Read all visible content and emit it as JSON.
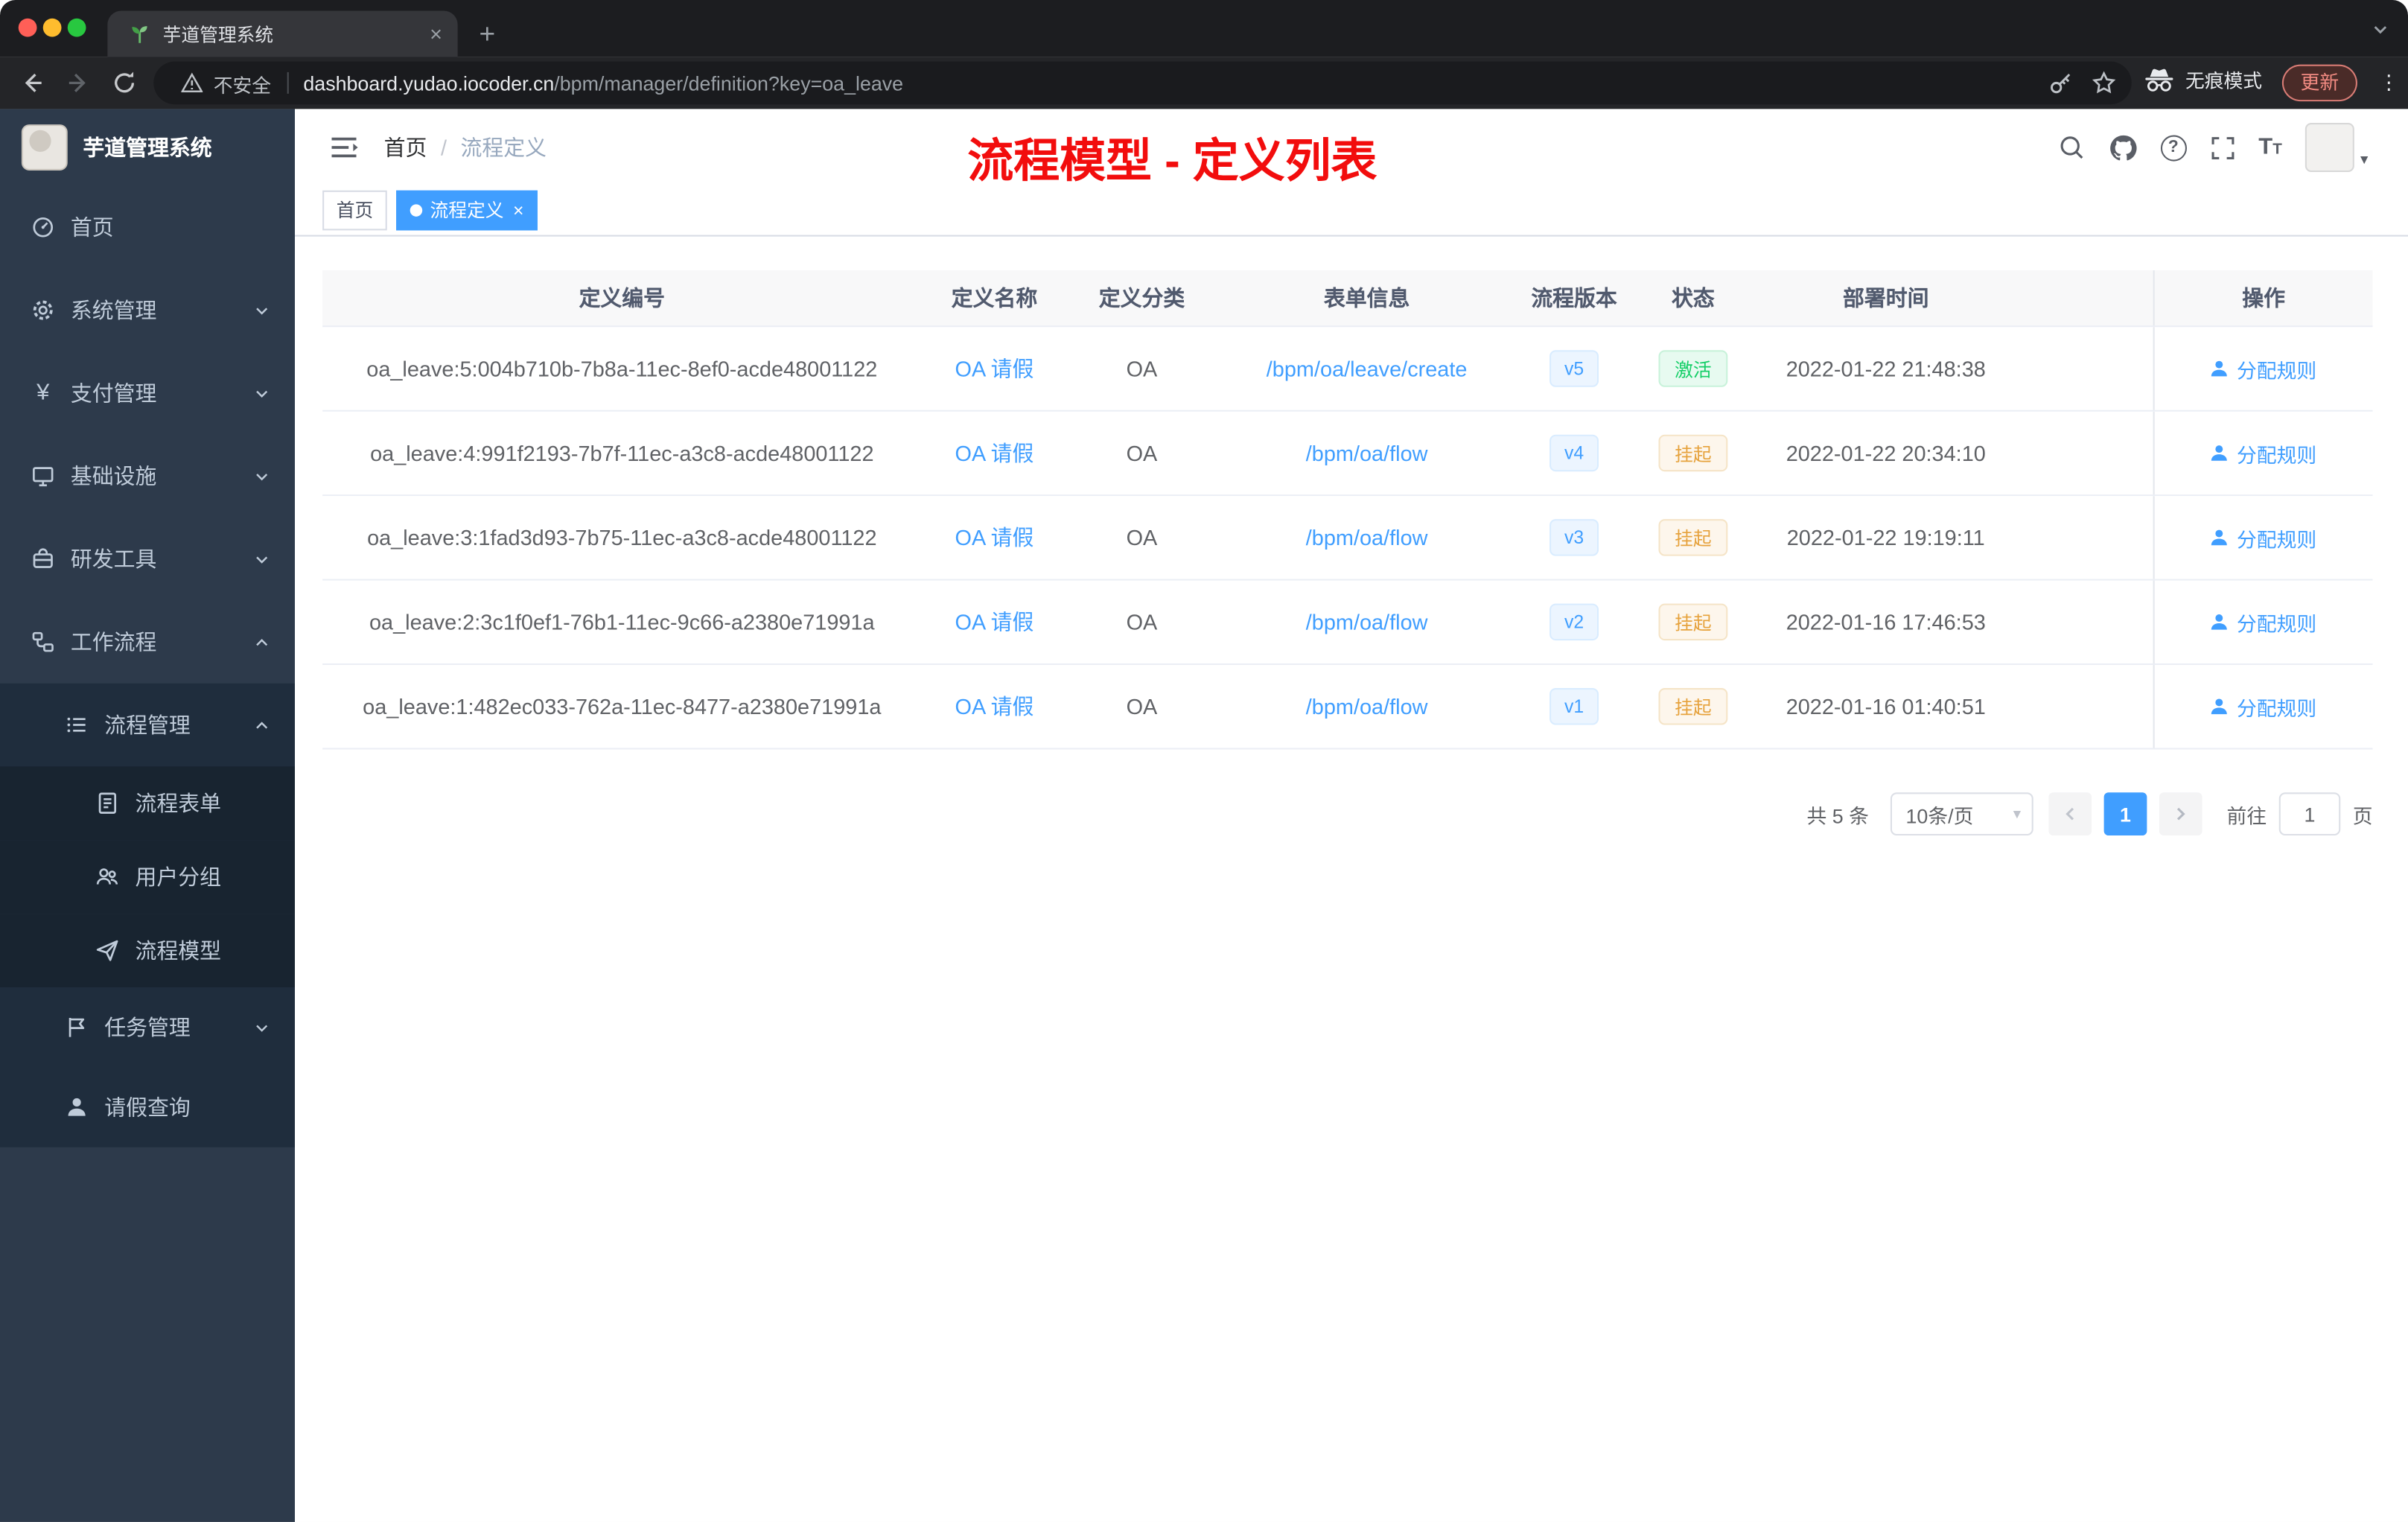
{
  "browser": {
    "tab_title": "芋道管理系统",
    "security_label": "不安全",
    "url_domain": "dashboard.yudao.iocoder.cn",
    "url_path": "/bpm/manager/definition?key=oa_leave",
    "incognito_label": "无痕模式",
    "update_label": "更新"
  },
  "sidebar": {
    "app_title": "芋道管理系统",
    "items": [
      {
        "label": "首页",
        "icon": "dashboard-icon"
      },
      {
        "label": "系统管理",
        "icon": "gear-icon",
        "arrow": "down"
      },
      {
        "label": "支付管理",
        "icon": "yen-icon",
        "arrow": "down"
      },
      {
        "label": "基础设施",
        "icon": "monitor-icon",
        "arrow": "down"
      },
      {
        "label": "研发工具",
        "icon": "toolbox-icon",
        "arrow": "down"
      },
      {
        "label": "工作流程",
        "icon": "workflow-icon",
        "arrow": "up"
      },
      {
        "label": "流程管理",
        "icon": "list-icon",
        "arrow": "up"
      },
      {
        "label": "流程表单",
        "icon": "form-icon"
      },
      {
        "label": "用户分组",
        "icon": "user-group-icon"
      },
      {
        "label": "流程模型",
        "icon": "send-icon"
      },
      {
        "label": "任务管理",
        "icon": "flag-icon",
        "arrow": "down"
      },
      {
        "label": "请假查询",
        "icon": "person-icon"
      }
    ]
  },
  "header": {
    "breadcrumb_home": "首页",
    "breadcrumb_sep": "/",
    "breadcrumb_current": "流程定义",
    "annotation": "流程模型 - 定义列表"
  },
  "tags_view": {
    "tags": [
      {
        "label": "首页"
      },
      {
        "label": "流程定义"
      }
    ]
  },
  "table": {
    "columns": [
      "定义编号",
      "定义名称",
      "定义分类",
      "表单信息",
      "流程版本",
      "状态",
      "部署时间",
      "操作"
    ],
    "rows": [
      {
        "id": "oa_leave:5:004b710b-7b8a-11ec-8ef0-acde48001122",
        "name": "OA 请假",
        "category": "OA",
        "form": "/bpm/oa/leave/create",
        "version": "v5",
        "status": "激活",
        "status_type": "success",
        "time": "2022-01-22 21:48:38",
        "action": "分配规则"
      },
      {
        "id": "oa_leave:4:991f2193-7b7f-11ec-a3c8-acde48001122",
        "name": "OA 请假",
        "category": "OA",
        "form": "/bpm/oa/flow",
        "version": "v4",
        "status": "挂起",
        "status_type": "warning",
        "time": "2022-01-22 20:34:10",
        "action": "分配规则"
      },
      {
        "id": "oa_leave:3:1fad3d93-7b75-11ec-a3c8-acde48001122",
        "name": "OA 请假",
        "category": "OA",
        "form": "/bpm/oa/flow",
        "version": "v3",
        "status": "挂起",
        "status_type": "warning",
        "time": "2022-01-22 19:19:11",
        "action": "分配规则"
      },
      {
        "id": "oa_leave:2:3c1f0ef1-76b1-11ec-9c66-a2380e71991a",
        "name": "OA 请假",
        "category": "OA",
        "form": "/bpm/oa/flow",
        "version": "v2",
        "status": "挂起",
        "status_type": "warning",
        "time": "2022-01-16 17:46:53",
        "action": "分配规则"
      },
      {
        "id": "oa_leave:1:482ec033-762a-11ec-8477-a2380e71991a",
        "name": "OA 请假",
        "category": "OA",
        "form": "/bpm/oa/flow",
        "version": "v1",
        "status": "挂起",
        "status_type": "warning",
        "time": "2022-01-16 01:40:51",
        "action": "分配规则"
      }
    ]
  },
  "pagination": {
    "total_label": "共 5 条",
    "page_size": "10条/页",
    "current_page": "1",
    "goto_label": "前往",
    "goto_value": "1",
    "page_unit": "页"
  },
  "colors": {
    "accent": "#409eff",
    "success": "#13ce66",
    "warning": "#e6a23c",
    "annotation_red": "#f20d0d",
    "sidebar_bg": "#2d3a4b"
  }
}
